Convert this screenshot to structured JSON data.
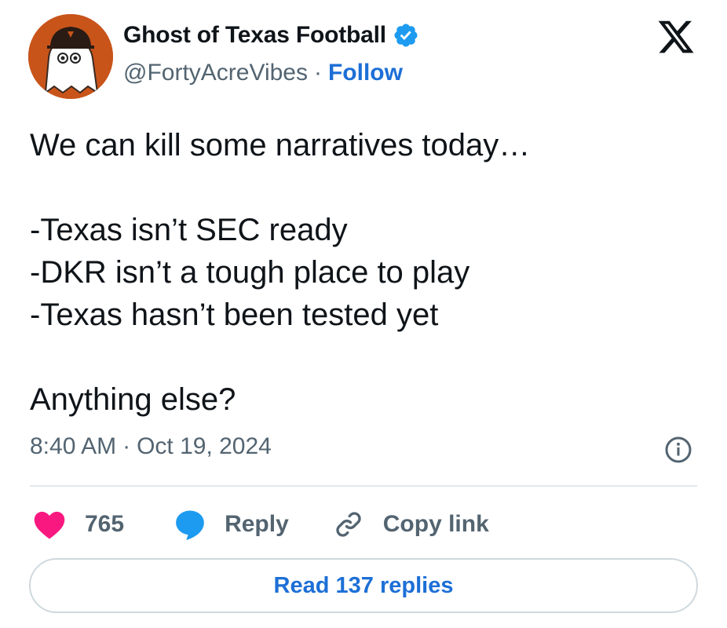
{
  "author": {
    "display_name": "Ghost of Texas Football",
    "handle": "@FortyAcreVibes",
    "follow_label": "Follow",
    "separator": "·",
    "avatar_icon": "ghost-avatar-icon",
    "verified_icon": "verified-badge-icon"
  },
  "tweet": {
    "lines": [
      "We can kill some narratives today…",
      "-Texas isn’t SEC ready",
      "-DKR isn’t a tough place to play",
      "-Texas hasn’t been tested yet",
      "Anything else?"
    ],
    "time": "8:40 AM",
    "date": "Oct 19, 2024",
    "meta_separator": "·"
  },
  "actions": {
    "like_count": "765",
    "reply_label": "Reply",
    "copy_link_label": "Copy link"
  },
  "read_replies_label": "Read 137 replies",
  "colors": {
    "accent": "#1d6fd6",
    "heart": "#f91880",
    "reply_blue": "#1d9bf0",
    "muted": "#536471",
    "avatar_bg": "#c8541a"
  }
}
